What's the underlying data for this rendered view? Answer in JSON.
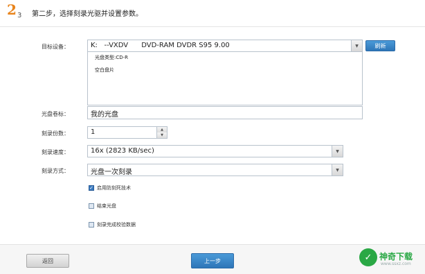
{
  "header": {
    "step_number": "2",
    "step_total": "3",
    "title": "第二步，选择刻录光驱并设置参数。"
  },
  "device": {
    "label": "目标设备：",
    "selected": "K:   --VXDV      DVD-RAM DVDR S95 9.00",
    "refresh_label": "刷新",
    "info_lines": [
      "光盘类型:CD-R",
      "空白盘片"
    ]
  },
  "disc_label": {
    "label": "光盘卷标：",
    "value": "我的光盘"
  },
  "copies": {
    "label": "刻录份数：",
    "value": "1"
  },
  "speed": {
    "label": "刻录速度：",
    "selected": "16x (2823 KB/sec)"
  },
  "mode": {
    "label": "刻录方式：",
    "selected": "光盘一次刻录"
  },
  "options": [
    {
      "label": "启用防刻死技术",
      "checked": true
    },
    {
      "label": "结束光盘",
      "checked": false
    },
    {
      "label": "刻录完成校验数据",
      "checked": false
    }
  ],
  "footer": {
    "back_label": "返回",
    "prev_label": "上一步"
  },
  "watermark": {
    "logo_glyph": "✓",
    "text": "神奇下载",
    "url": "www.ssxz.com"
  }
}
